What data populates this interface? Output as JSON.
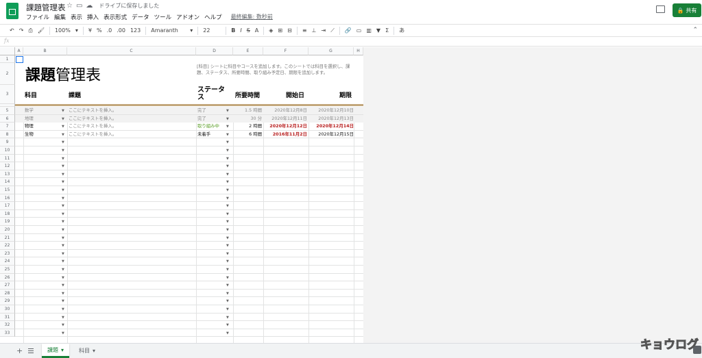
{
  "header": {
    "doc_title": "課題管理表",
    "saved_status": "ドライブに保存しました",
    "last_edit": "最終編集: 数秒前",
    "share_label": "共有"
  },
  "menu": [
    "ファイル",
    "編集",
    "表示",
    "挿入",
    "表示形式",
    "データ",
    "ツール",
    "アドオン",
    "ヘルプ"
  ],
  "toolbar": {
    "zoom": "100%",
    "currency": "¥",
    "percent": "%",
    "dec_less": ".0",
    "dec_more": ".00",
    "format_more": "123",
    "font": "Amaranth",
    "font_size": "22",
    "bold": "B",
    "italic": "I",
    "strike": "S",
    "text_color": "A",
    "input_tool": "あ"
  },
  "formula_bar": {
    "fx": "fx",
    "value": ""
  },
  "columns": [
    "A",
    "B",
    "C",
    "D",
    "E",
    "F",
    "G",
    "H"
  ],
  "rows": [
    "1",
    "2",
    "3",
    "4",
    "5",
    "6",
    "7",
    "8",
    "9",
    "10",
    "11",
    "12",
    "13",
    "14",
    "15",
    "16",
    "17",
    "18",
    "19",
    "20",
    "21",
    "22",
    "23",
    "24",
    "25",
    "26",
    "27",
    "28",
    "29",
    "30",
    "31",
    "32",
    "33"
  ],
  "sheet": {
    "title_bold": "課題",
    "title_rest": "管理表",
    "description": "[科目] シートに科目やコースを追加します。このシートでは科目を選択し、課題、ステータス、所要時間、取り組み予定日、期限を追加します。",
    "headers": {
      "subject": "科目",
      "task": "課題",
      "status": "ステータス",
      "time": "所要時間",
      "start": "開始日",
      "due": "期限"
    },
    "data_rows": [
      {
        "subject": "数学",
        "task": "ここにテキストを挿入。",
        "status": "完了",
        "time": "1.5 時間",
        "start": "2020年12月8日",
        "due": "2020年12月10日"
      },
      {
        "subject": "地理",
        "task": "ここにテキストを挿入。",
        "status": "完了",
        "time": "30 分",
        "start": "2020年12月11日",
        "due": "2020年12月13日"
      },
      {
        "subject": "物理",
        "task": "ここにテキストを挿入。",
        "status": "取り組み中",
        "time": "2 時間",
        "start": "2020年12月12日",
        "due": "2020年12月14日"
      },
      {
        "subject": "生物",
        "task": "ここにテキストを挿入。",
        "status": "未着手",
        "time": "6 時間",
        "start": "2016年11月2日",
        "due": "2020年12月15日"
      }
    ]
  },
  "tabs": {
    "active": "課題",
    "inactive": "科目"
  },
  "watermark": "キョウログ"
}
